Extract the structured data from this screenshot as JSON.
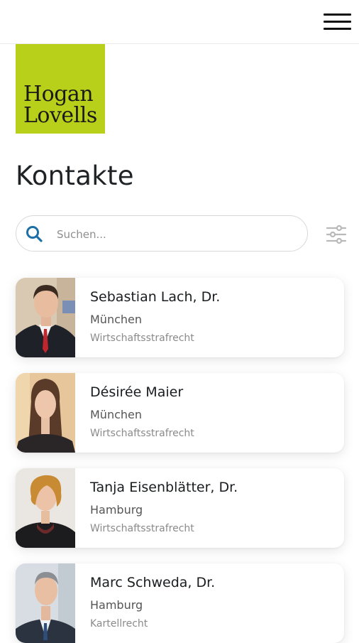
{
  "brand": {
    "line1": "Hogan",
    "line2": "Lovells",
    "color": "#b8d01a"
  },
  "page": {
    "title": "Kontakte"
  },
  "search": {
    "placeholder": "Suchen...",
    "value": ""
  },
  "icons": {
    "menu": "hamburger-icon",
    "search": "search-icon",
    "filter": "sliders-icon"
  },
  "contacts": [
    {
      "name": "Sebastian Lach, Dr.",
      "city": "München",
      "area": "Wirtschaftsstrafrecht"
    },
    {
      "name": "Désirée Maier",
      "city": "München",
      "area": "Wirtschaftsstrafrecht"
    },
    {
      "name": "Tanja Eisenblätter, Dr.",
      "city": "Hamburg",
      "area": "Wirtschaftsstrafrecht"
    },
    {
      "name": "Marc Schweda, Dr.",
      "city": "Hamburg",
      "area": "Kartellrecht"
    }
  ]
}
